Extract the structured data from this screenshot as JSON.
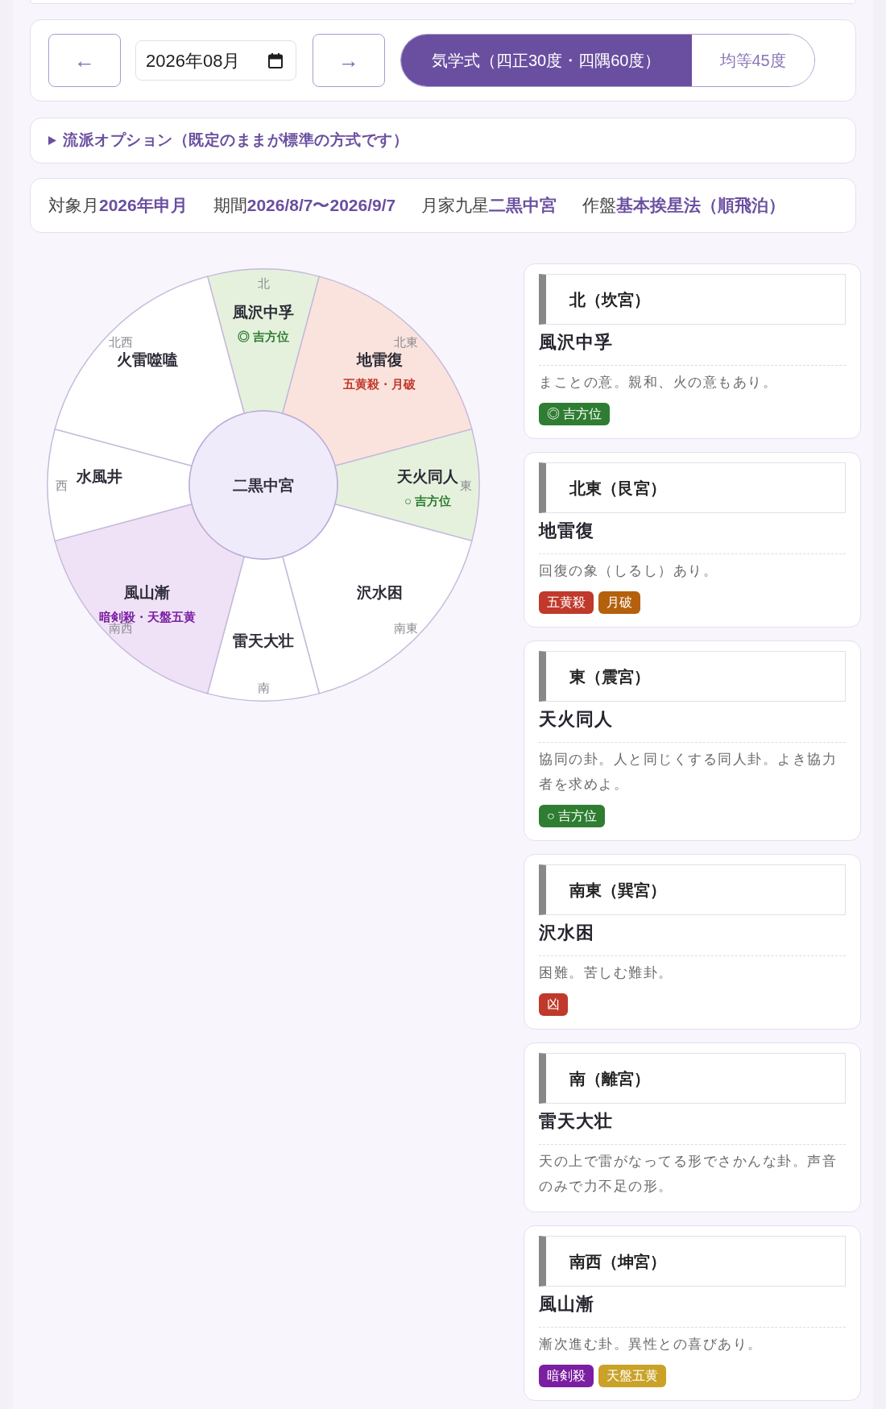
{
  "controls": {
    "prev": "←",
    "month": "2026年08月",
    "next": "→",
    "modes": [
      {
        "label": "気学式（四正30度・四隅60度）",
        "selected": true
      },
      {
        "label": "均等45度",
        "selected": false
      }
    ]
  },
  "options": {
    "label": "流派オプション（既定のままが標準の方式です）",
    "expanded": false
  },
  "summary": [
    {
      "label": "対象月",
      "value": "2026年申月"
    },
    {
      "label": "期間",
      "value": "2026/8/7〜2026/9/7"
    },
    {
      "label": "月家九星",
      "value": "二黒中宮"
    },
    {
      "label": "作盤",
      "value": "基本挨星法（順飛泊）"
    }
  ],
  "wheel": {
    "center": "二黒中宮",
    "segments": [
      {
        "direction": "北",
        "name": "風沢中孚",
        "tag": "◎ 吉方位",
        "kind": "lucky"
      },
      {
        "direction": "北東",
        "name": "地雷復",
        "tag": "五黄殺・月破",
        "kind": "misfortune"
      },
      {
        "direction": "東",
        "name": "天火同人",
        "tag": "○ 吉方位",
        "kind": "lucky"
      },
      {
        "direction": "南東",
        "name": "沢水困",
        "kind": "plain"
      },
      {
        "direction": "南",
        "name": "雷天大壮",
        "kind": "plain"
      },
      {
        "direction": "南西",
        "name": "風山漸",
        "tag": "暗剣殺・天盤五黄",
        "kind": "dark"
      },
      {
        "direction": "西",
        "name": "水風井",
        "kind": "plain"
      },
      {
        "direction": "北西",
        "name": "火雷噬嗑",
        "kind": "plain"
      }
    ]
  },
  "cards": [
    {
      "heading": "北（坎宮）",
      "name": "風沢中孚",
      "description": "まことの意。親和、火の意もあり。",
      "tags": [
        {
          "label": "◎ 吉方位",
          "color": "#2e7d32"
        }
      ]
    },
    {
      "heading": "北東（艮宮）",
      "name": "地雷復",
      "description": "回復の象（しるし）あり。",
      "tags": [
        {
          "label": "五黄殺",
          "color": "#c0392b"
        },
        {
          "label": "月破",
          "color": "#b5600c"
        }
      ]
    },
    {
      "heading": "東（震宮）",
      "name": "天火同人",
      "description": "協同の卦。人と同じくする同人卦。よき協力者を求めよ。",
      "tags": [
        {
          "label": "○ 吉方位",
          "color": "#2e7d32"
        }
      ]
    },
    {
      "heading": "南東（巽宮）",
      "name": "沢水困",
      "description": "困難。苦しむ難卦。",
      "tags": [
        {
          "label": "凶",
          "color": "#c0392b"
        }
      ]
    },
    {
      "heading": "南（離宮）",
      "name": "雷天大壮",
      "description": "天の上で雷がなってる形でさかんな卦。声音のみで力不足の形。"
    },
    {
      "heading": "南西（坤宮）",
      "name": "風山漸",
      "description": "漸次進む卦。異性との喜びあり。",
      "tags": [
        {
          "label": "暗剣殺",
          "color": "#7b1fa2"
        },
        {
          "label": "天盤五黄",
          "color": "#c9a227"
        }
      ]
    }
  ]
}
